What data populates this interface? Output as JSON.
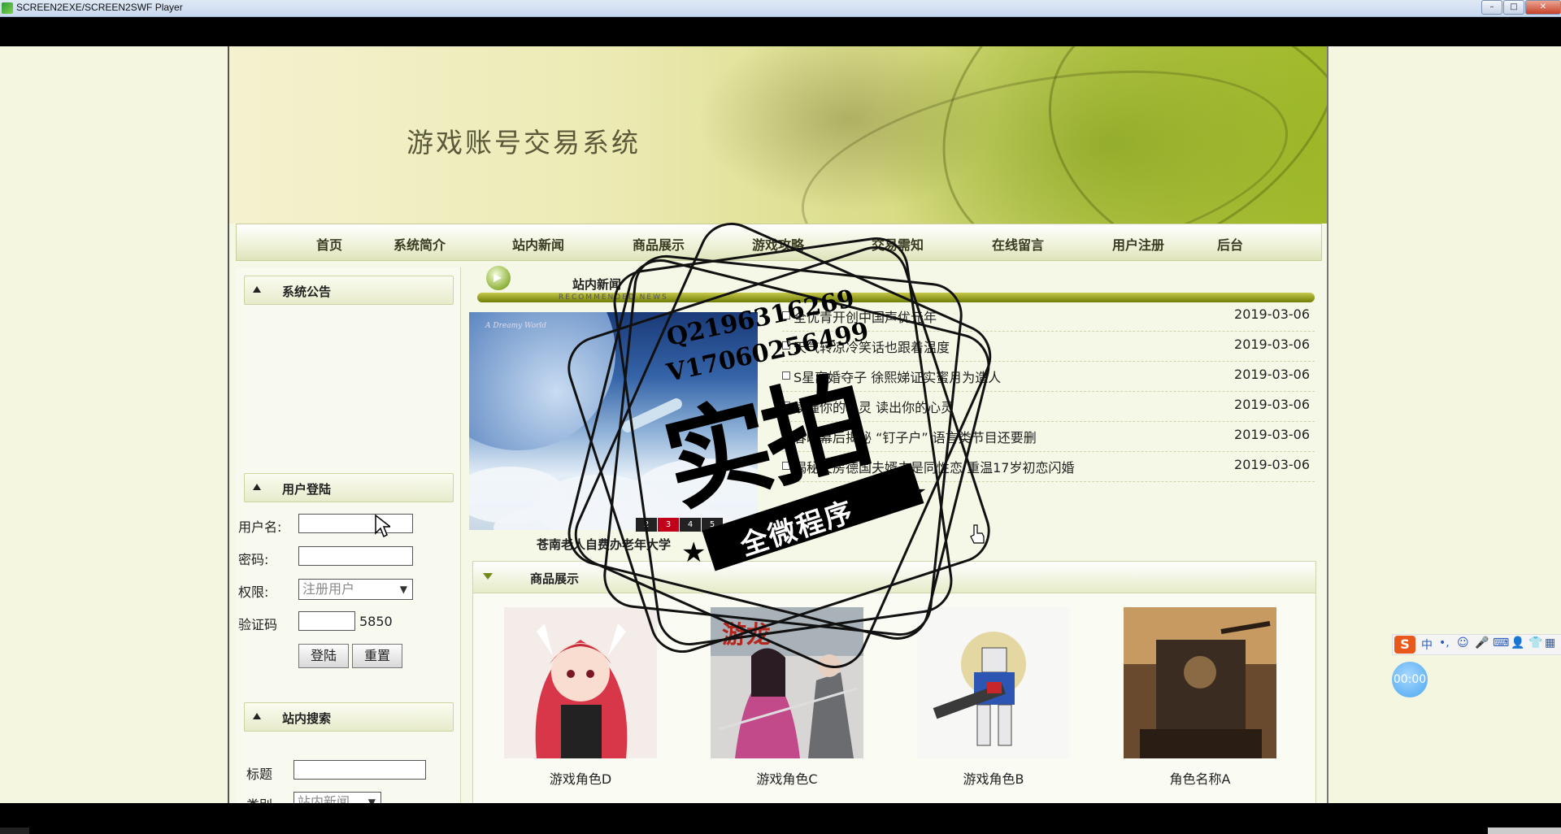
{
  "window": {
    "title": "SCREEN2EXE/SCREEN2SWF Player",
    "buttons": {
      "minimize": "–",
      "maximize": "□",
      "close": "✕"
    }
  },
  "site": {
    "title": "游戏账号交易系统"
  },
  "nav": {
    "items": [
      "首页",
      "系统简介",
      "站内新闻",
      "商品展示",
      "游戏攻略",
      "交易需知",
      "在线留言",
      "用户注册",
      "后台"
    ]
  },
  "sidebar": {
    "announcement_title": "系统公告",
    "login_title": "用户登陆",
    "login": {
      "username_label": "用户名:",
      "password_label": "密码:",
      "role_label": "权限:",
      "role_selected": "注册用户",
      "captcha_label": "验证码",
      "captcha_code": "5850",
      "login_button": "登陆",
      "reset_button": "重置"
    },
    "search_title": "站内搜索",
    "search": {
      "title_label": "标题",
      "category_label": "类别",
      "category_selected": "站内新闻"
    }
  },
  "news": {
    "title": "站内新闻",
    "subtitle": "RECOMMENDED NEWS",
    "image_caption": "苍南老人自费办老年大学",
    "image_script": "A Dreamy World",
    "pager": [
      "2",
      "3",
      "4",
      "5"
    ],
    "pager_active": "3",
    "items": [
      {
        "title": "全优青开创中国声优元年",
        "date": "2019-03-06"
      },
      {
        "title": "天气转凉冷笑话也跟着温度",
        "date": "2019-03-06"
      },
      {
        "title": "S星离婚夺子 徐熙娣证实蜜月为造人",
        "date": "2019-03-06"
      },
      {
        "title": "读懂你的心灵 读出你的心灵",
        "date": "2019-03-06"
      },
      {
        "title": "春晚幕后揭秘 “钉子户” 语言类节目还要删",
        "date": "2019-03-06"
      },
      {
        "title": "揭秘文房德国夫婿夫是同性恋 重温17岁初恋闪婚",
        "date": "2019-03-06"
      }
    ]
  },
  "products": {
    "title": "商品展示",
    "items": [
      {
        "name": "游戏角色D",
        "art": "anime-girl"
      },
      {
        "name": "游戏角色C",
        "art": "swordswoman"
      },
      {
        "name": "游戏角色B",
        "art": "mecha"
      },
      {
        "name": "角色名称A",
        "art": "war-machine"
      }
    ]
  },
  "watermark": {
    "line1": "Q2196316269",
    "line2": "V17060256499",
    "big": "实拍",
    "ribbon": "全微程序"
  },
  "ime": {
    "brand": "S",
    "glyphs": [
      "中",
      "•,",
      "☺",
      "🎤",
      "⌨",
      "👤",
      "👕",
      "▦"
    ]
  },
  "clock": {
    "time": "00:00"
  },
  "colors": {
    "accent_green": "#8fa51a",
    "nav_bg": "#eef1d8",
    "page_bg": "#f5f8e6",
    "pager_active": "#c1001a"
  }
}
